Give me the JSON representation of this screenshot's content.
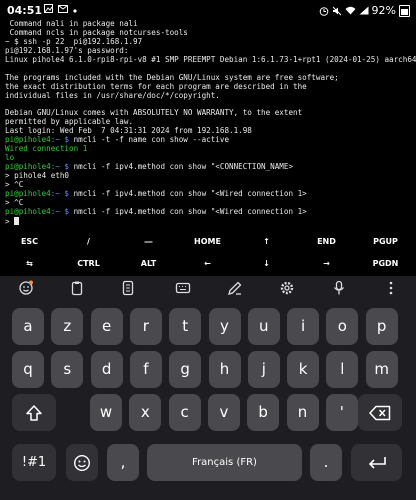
{
  "status_bar": {
    "time": "04:51",
    "battery": "92%",
    "icons": [
      "gallery-icon",
      "mail-icon",
      "dot-icon",
      "alarm-icon",
      "mute-icon",
      "wifi-icon",
      "signal-icon"
    ]
  },
  "terminal": {
    "lines": [
      [
        {
          "t": " Command nali in package nali",
          "c": ""
        }
      ],
      [
        {
          "t": " Command ncls in package notcurses-tools",
          "c": ""
        }
      ],
      [
        {
          "t": "~ $ ssh -p 22  pi@192.168.1.97",
          "c": ""
        }
      ],
      [
        {
          "t": "pi@192.168.1.97's password:",
          "c": ""
        }
      ],
      [
        {
          "t": "Linux pihole4 6.1.0-rpi8-rpi-v8 #1 SMP PREEMPT Debian 1:6.1.73-1+rpt1 (2024-01-25) aarch64",
          "c": ""
        }
      ],
      [
        {
          "t": "",
          "c": ""
        }
      ],
      [
        {
          "t": "The programs included with the Debian GNU/Linux system are free software;",
          "c": ""
        }
      ],
      [
        {
          "t": "the exact distribution terms for each program are described in the",
          "c": ""
        }
      ],
      [
        {
          "t": "individual files in /usr/share/doc/*/copyright.",
          "c": ""
        }
      ],
      [
        {
          "t": "",
          "c": ""
        }
      ],
      [
        {
          "t": "Debian GNU/Linux comes with ABSOLUTELY NO WARRANTY, to the extent",
          "c": ""
        }
      ],
      [
        {
          "t": "permitted by applicable law.",
          "c": ""
        }
      ],
      [
        {
          "t": "Last login: Wed Feb  7 04:31:31 2024 from 192.168.1.98",
          "c": ""
        }
      ],
      [
        {
          "t": "pi@pihole4",
          "c": "g"
        },
        {
          "t": ":~ $ ",
          "c": "b"
        },
        {
          "t": "nmcli -t -f name con show --active",
          "c": ""
        }
      ],
      [
        {
          "t": "Wired connection 1",
          "c": "g"
        }
      ],
      [
        {
          "t": "lo",
          "c": "g"
        }
      ],
      [
        {
          "t": "pi@pihole4",
          "c": "g"
        },
        {
          "t": ":~ $ ",
          "c": "b"
        },
        {
          "t": "nmcli -f ipv4.method con show \"<CONNECTION_NAME>",
          "c": ""
        }
      ],
      [
        {
          "t": "> pihole4 eth0",
          "c": ""
        }
      ],
      [
        {
          "t": "> ^C",
          "c": ""
        }
      ],
      [
        {
          "t": "pi@pihole4",
          "c": "g"
        },
        {
          "t": ":~ $ ",
          "c": "b"
        },
        {
          "t": "nmcli -f ipv4.method con show \"<Wired connection 1>",
          "c": ""
        }
      ],
      [
        {
          "t": "> ^C",
          "c": ""
        }
      ],
      [
        {
          "t": "pi@pihole4",
          "c": "g"
        },
        {
          "t": ":~ $ ",
          "c": "b"
        },
        {
          "t": "nmcli -f ipv4.method con show \"<Wired connection 1>",
          "c": ""
        }
      ],
      [
        {
          "t": "> ",
          "c": ""
        }
      ]
    ]
  },
  "extra_keys": {
    "row1": [
      "ESC",
      "/",
      "―",
      "HOME",
      "↑",
      "END",
      "PGUP"
    ],
    "row2": [
      "⇆",
      "CTRL",
      "ALT",
      "←",
      "↓",
      "→",
      "PGDN"
    ]
  },
  "keyboard": {
    "row1": [
      "a",
      "z",
      "e",
      "r",
      "t",
      "y",
      "u",
      "i",
      "o",
      "p"
    ],
    "row2": [
      "q",
      "s",
      "d",
      "f",
      "g",
      "h",
      "j",
      "k",
      "l",
      "m"
    ],
    "row3": [
      "w",
      "x",
      "c",
      "v",
      "b",
      "n",
      "'"
    ],
    "symbols": "!#1",
    "comma": ",",
    "space": "Français (FR)",
    "period": "."
  },
  "colors": {
    "prompt_user": "#2fce36",
    "prompt_path": "#5b8dff",
    "terminal_text": "#eaeaea",
    "keyboard_bg": "#1e1d22",
    "key_bg": "#4a4a4e"
  }
}
